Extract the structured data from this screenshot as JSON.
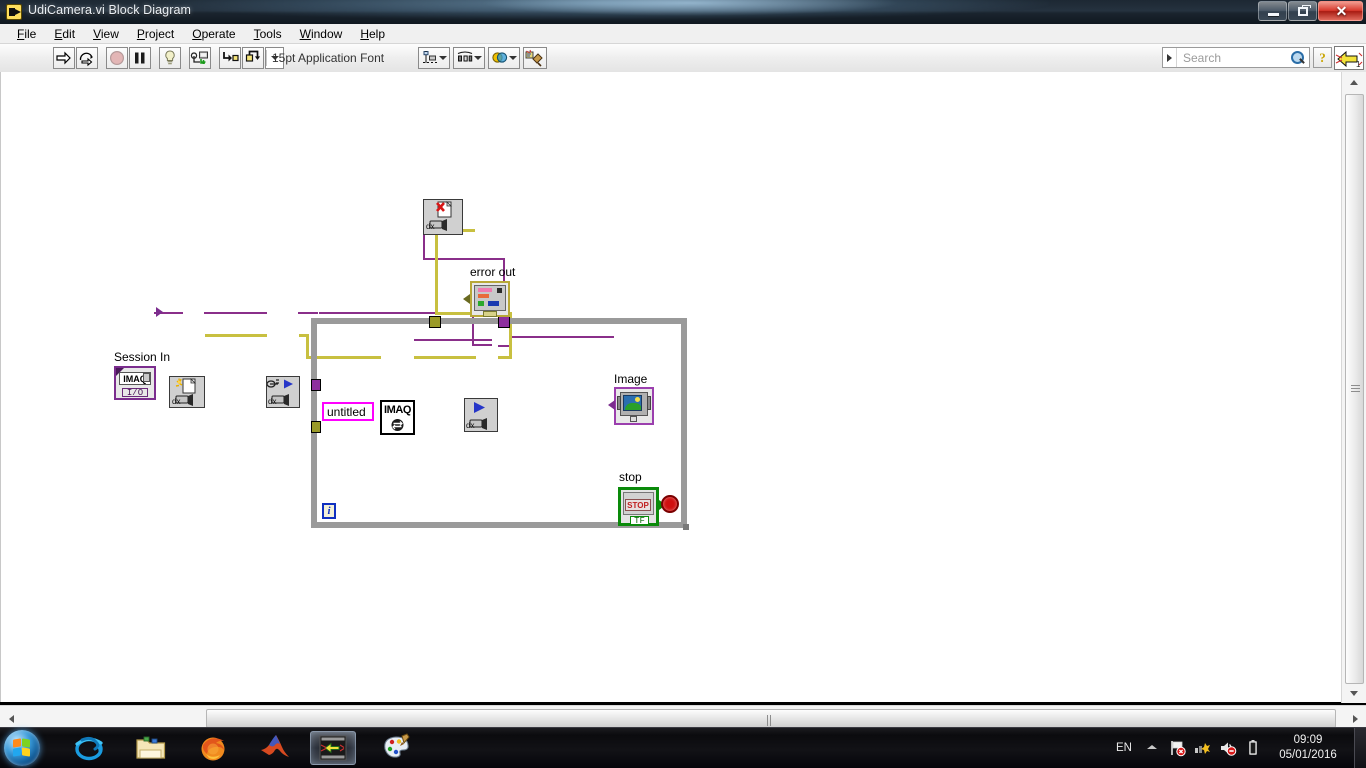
{
  "window": {
    "title": "UdiCamera.vi Block Diagram",
    "icon": "labview-vi-icon",
    "minimize_label": "",
    "maximize_label": "",
    "close_label": "✕"
  },
  "menubar": {
    "items": [
      {
        "label": "File",
        "accel": "F"
      },
      {
        "label": "Edit",
        "accel": "E"
      },
      {
        "label": "View",
        "accel": "V"
      },
      {
        "label": "Project",
        "accel": "P"
      },
      {
        "label": "Operate",
        "accel": "O"
      },
      {
        "label": "Tools",
        "accel": "T"
      },
      {
        "label": "Window",
        "accel": "W"
      },
      {
        "label": "Help",
        "accel": "H"
      }
    ]
  },
  "toolbar": {
    "run_tip": "Run",
    "run_continuous_tip": "Run Continuously",
    "abort_tip": "Abort Execution",
    "pause_tip": "Pause",
    "highlight_tip": "Highlight Execution",
    "retain_values_tip": "Retain Wire Values",
    "step_into_tip": "Step Into",
    "step_over_tip": "Step Over",
    "step_out_tip": "Step Out",
    "font_label": "15pt Application Font",
    "align_tip": "Align Objects",
    "distribute_tip": "Distribute Objects",
    "resize_tip": "Resize Objects",
    "reorder_tip": "Reorder",
    "clean_up_tip": "Clean Up Diagram",
    "help_label": "?",
    "lv_badge": "1"
  },
  "search": {
    "placeholder": "Search",
    "value": "",
    "icon": "magnifier-icon"
  },
  "diagram": {
    "labels": {
      "session_in": "Session In",
      "error_out": "error out",
      "image": "Image",
      "stop": "stop",
      "untitled": "untitled",
      "iteration": "i",
      "imaq_text": "IMAQ",
      "stop_button_text": "STOP",
      "bool_tf": "TF",
      "session_io": "I/O",
      "session_imaq": "IMAQ",
      "dx_tag": "dx"
    },
    "nodes": [
      {
        "name": "imaq-usb-session-in-control",
        "type": "control-terminal",
        "label": "Session In"
      },
      {
        "name": "imaq-usb-snap-vi",
        "type": "vi-node",
        "label": ""
      },
      {
        "name": "imaq-usb-grab-setup-vi",
        "type": "vi-node",
        "label": ""
      },
      {
        "name": "imaq-create-vi",
        "type": "imaq-node",
        "label": "IMAQ"
      },
      {
        "name": "imaq-usb-grab-acquire-vi",
        "type": "vi-node",
        "label": ""
      },
      {
        "name": "imaq-usb-close-vi",
        "type": "vi-node",
        "label": ""
      },
      {
        "name": "error-out-indicator",
        "type": "indicator-terminal",
        "label": "error out"
      },
      {
        "name": "image-display-indicator",
        "type": "indicator-terminal",
        "label": "Image"
      },
      {
        "name": "stop-boolean-control",
        "type": "control-terminal",
        "label": "stop"
      },
      {
        "name": "while-loop",
        "type": "structure",
        "label": ""
      }
    ],
    "colors": {
      "imaq_wire": "#8a2f8a",
      "error_wire": "#c8c040",
      "loop_border": "#9a9a9a",
      "string_accent": "#ff00ff",
      "boolean_accent": "#0a8a0a",
      "control_accent": "#7b2d8e",
      "canvas": "#ffffff"
    }
  },
  "taskbar": {
    "start_tip": "Start",
    "apps": [
      {
        "name": "internet-explorer",
        "label": "Internet Explorer",
        "active": false
      },
      {
        "name": "windows-explorer",
        "label": "Windows Explorer",
        "active": false
      },
      {
        "name": "firefox",
        "label": "Mozilla Firefox",
        "active": false
      },
      {
        "name": "matlab",
        "label": "MATLAB",
        "active": false
      },
      {
        "name": "labview",
        "label": "LabVIEW",
        "active": true
      },
      {
        "name": "paint",
        "label": "Paint",
        "active": false
      }
    ],
    "tray": {
      "language": "EN",
      "show_hidden_tip": "Show hidden icons",
      "icons": [
        "action-center-icon",
        "network-icon",
        "volume-muted-icon",
        "battery-icon"
      ],
      "time": "09:09",
      "date": "05/01/2016"
    }
  }
}
